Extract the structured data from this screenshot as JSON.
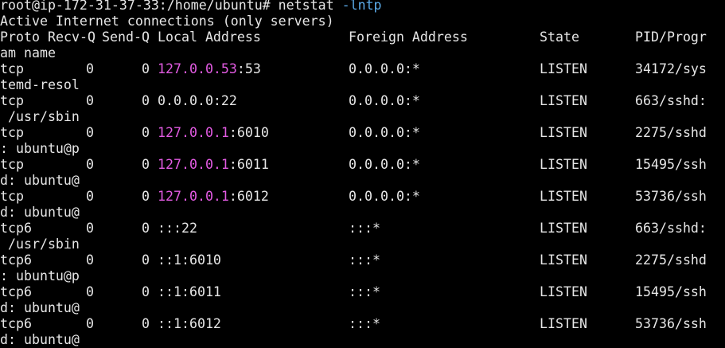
{
  "prompt": {
    "text": "root@ip-172-31-37-33:/home/ubuntu# netstat ",
    "flag": "-lntp"
  },
  "heading": "Active Internet connections (only servers)",
  "header": {
    "proto": "Proto",
    "recv_q": "Recv-Q",
    "send_q": "Send-Q",
    "local": "Local Address",
    "foreign": "Foreign Address",
    "state": "State",
    "pid": "PID/Progr",
    "pid_wrap": "am name"
  },
  "rows": [
    {
      "proto": "tcp",
      "recv": "0",
      "send": "0",
      "local_ip": "127.0.0.53",
      "local_port": ":53",
      "foreign": "0.0.0.0:*",
      "state": "LISTEN",
      "pid": "34172/sys",
      "wrap": "temd-resol"
    },
    {
      "proto": "tcp",
      "recv": "0",
      "send": "0",
      "local_ip": "",
      "local_port": "0.0.0.0:22",
      "foreign": "0.0.0.0:*",
      "state": "LISTEN",
      "pid": "663/sshd:",
      "wrap": " /usr/sbin"
    },
    {
      "proto": "tcp",
      "recv": "0",
      "send": "0",
      "local_ip": "127.0.0.1",
      "local_port": ":6010",
      "foreign": "0.0.0.0:*",
      "state": "LISTEN",
      "pid": "2275/sshd",
      "wrap": ": ubuntu@p"
    },
    {
      "proto": "tcp",
      "recv": "0",
      "send": "0",
      "local_ip": "127.0.0.1",
      "local_port": ":6011",
      "foreign": "0.0.0.0:*",
      "state": "LISTEN",
      "pid": "15495/ssh",
      "wrap": "d: ubuntu@"
    },
    {
      "proto": "tcp",
      "recv": "0",
      "send": "0",
      "local_ip": "127.0.0.1",
      "local_port": ":6012",
      "foreign": "0.0.0.0:*",
      "state": "LISTEN",
      "pid": "53736/ssh",
      "wrap": "d: ubuntu@"
    },
    {
      "proto": "tcp6",
      "recv": "0",
      "send": "0",
      "local_ip": "",
      "local_port": ":::22",
      "foreign": ":::*",
      "state": "LISTEN",
      "pid": "663/sshd:",
      "wrap": " /usr/sbin"
    },
    {
      "proto": "tcp6",
      "recv": "0",
      "send": "0",
      "local_ip": "",
      "local_port": "::1:6010",
      "foreign": ":::*",
      "state": "LISTEN",
      "pid": "2275/sshd",
      "wrap": ": ubuntu@p"
    },
    {
      "proto": "tcp6",
      "recv": "0",
      "send": "0",
      "local_ip": "",
      "local_port": "::1:6011",
      "foreign": ":::*",
      "state": "LISTEN",
      "pid": "15495/ssh",
      "wrap": "d: ubuntu@"
    },
    {
      "proto": "tcp6",
      "recv": "0",
      "send": "0",
      "local_ip": "",
      "local_port": "::1:6012",
      "foreign": ":::*",
      "state": "LISTEN",
      "pid": "53736/ssh",
      "wrap": "d: ubuntu@"
    }
  ],
  "colors": {
    "background": "#000000",
    "text": "#e6e6e6",
    "flag": "#5aa9e6",
    "ip_highlight": "#e25be2"
  }
}
